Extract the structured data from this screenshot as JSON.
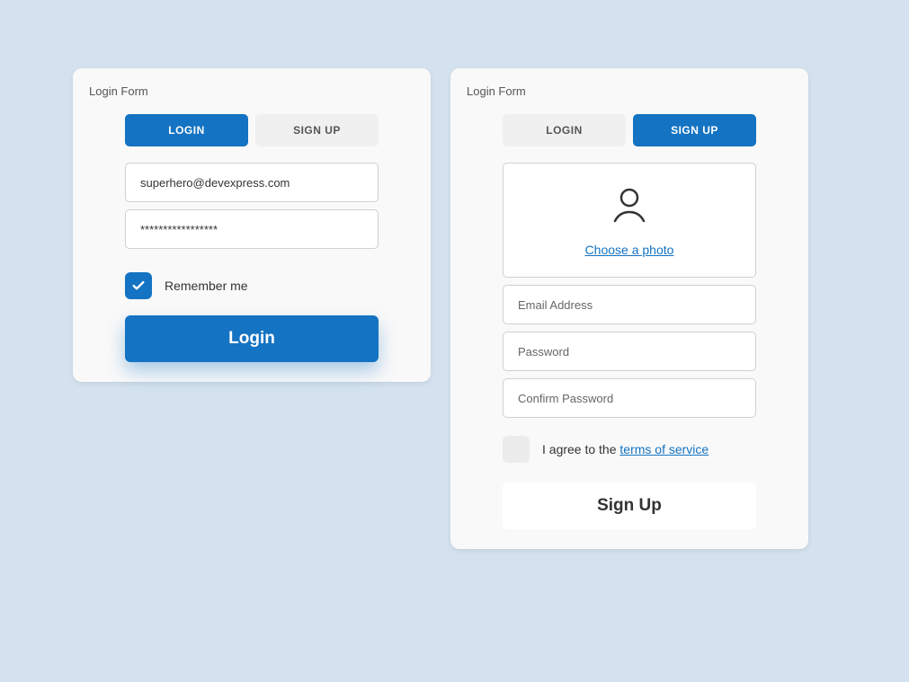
{
  "left": {
    "title": "Login Form",
    "tabs": {
      "login": "LOGIN",
      "signup": "SIGN UP"
    },
    "email_value": "superhero@devexpress.com",
    "password_value": "*****************",
    "remember_label": "Remember me",
    "submit_label": "Login"
  },
  "right": {
    "title": "Login Form",
    "tabs": {
      "login": "LOGIN",
      "signup": "SIGN UP"
    },
    "choose_photo": "Choose a photo",
    "email_placeholder": "Email Address",
    "password_placeholder": "Password",
    "confirm_placeholder": "Confirm Password",
    "agree_prefix": "I agree to the ",
    "terms_link": "terms of service",
    "submit_label": "Sign Up"
  }
}
